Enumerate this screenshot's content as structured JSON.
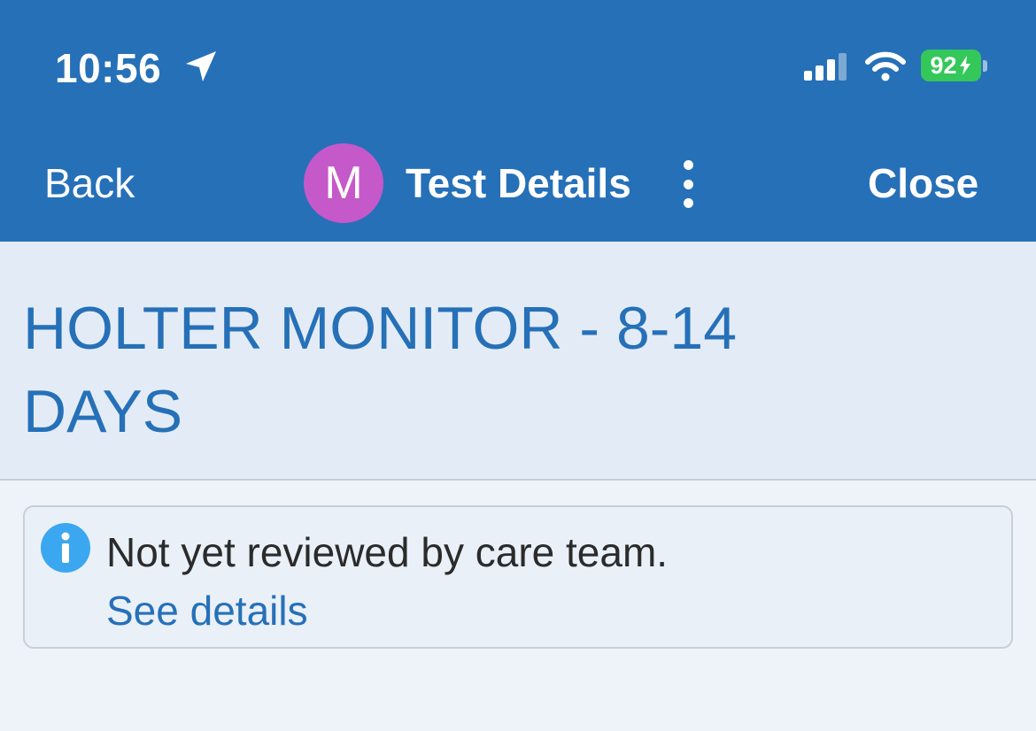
{
  "status_bar": {
    "time": "10:56",
    "battery_percent": "92",
    "icons": [
      "location-arrow-icon",
      "cellular-signal-icon",
      "wifi-icon",
      "battery-icon",
      "charging-bolt-icon"
    ]
  },
  "nav": {
    "back_label": "Back",
    "avatar_initial": "M",
    "title": "Test Details",
    "close_label": "Close",
    "more_icon": "vertical-ellipsis-icon"
  },
  "page": {
    "title": "HOLTER MONITOR - 8-14 DAYS"
  },
  "notice": {
    "icon": "info-icon",
    "message": "Not yet reviewed by care team.",
    "link_label": "See details"
  },
  "colors": {
    "header_blue": "#2670b8",
    "avatar_purple": "#c559c9",
    "battery_green": "#34c759",
    "info_blue": "#3ba7f0",
    "title_area_bg": "#e3ecf6",
    "page_bg": "#eef3f9"
  }
}
